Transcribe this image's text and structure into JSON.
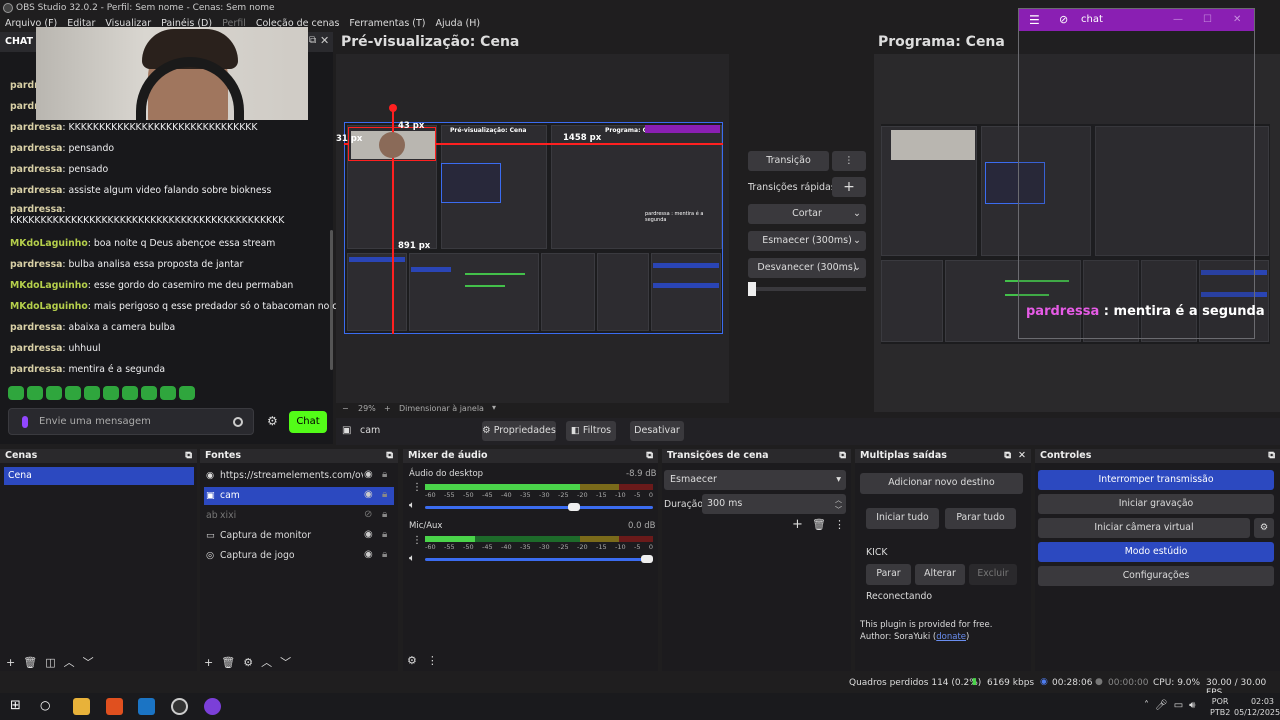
{
  "window": {
    "title": "OBS Studio 32.0.2 - Perfil: Sem nome - Cenas: Sem nome"
  },
  "menu": [
    "Arquivo (F)",
    "Editar",
    "Visualizar",
    "Painéis (D)",
    "Perfil",
    "Coleção de cenas",
    "Ferramentas (T)",
    "Ajuda (H)"
  ],
  "chat_dock": {
    "title": "CHAT K",
    "messages": [
      {
        "user": "pardre",
        "text": ""
      },
      {
        "user": "pardre",
        "text": ""
      },
      {
        "user": "pardressa",
        "text": "KKKKKKKKKKKKKKKKKKKKKKKKKKKKKKK"
      },
      {
        "user": "pardressa",
        "text": "pensando"
      },
      {
        "user": "pardressa",
        "text": "pensado"
      },
      {
        "user": "pardressa",
        "text": "assiste algum video falando sobre biokness"
      },
      {
        "user": "pardressa",
        "text": "KKKKKKKKKKKKKKKKKKKKKKKKKKKKKKKKKKKKKKKKKKKKK"
      },
      {
        "user": "MKdoLaguinho",
        "text": "boa noite q Deus abençoe essa stream"
      },
      {
        "user": "pardressa",
        "text": "bulba analisa essa proposta de jantar"
      },
      {
        "user": "MKdoLaguinho",
        "text": "esse gordo do casemiro me deu permaban"
      },
      {
        "user": "MKdoLaguinho",
        "text": "mais perigoso q esse predador só o tabacoman no cio"
      },
      {
        "user": "pardressa",
        "text": "abaixa a camera bulba"
      },
      {
        "user": "pardressa",
        "text": "uhhuul"
      },
      {
        "user": "pardressa",
        "text": "mentira é a segunda"
      }
    ],
    "input_placeholder": "Envie uma mensagem",
    "chat_button": "Chat",
    "accent": "#53fc18"
  },
  "preview": {
    "title": "Pré-visualização: Cena",
    "labels": {
      "top": "43 px",
      "left": "31 px",
      "right": "1458 px",
      "bottom": "891 px"
    },
    "zoom": "29%",
    "scale_mode": "Dimensionar à janela"
  },
  "program": {
    "title": "Programa: Cena"
  },
  "mini": {
    "prev_title": "Pré-visualização: Cena",
    "prog_title": "Programa: Cena",
    "overlay_msg": "pardressa : mentira é a segunda"
  },
  "chat_window": {
    "title": "chat",
    "overlay_user": "pardressa",
    "overlay_text": " : mentira é a segunda"
  },
  "transition_panel": {
    "transition": "Transição",
    "quick": "Transições rápidas",
    "cut": "Cortar",
    "fade": "Esmaecer (300ms)",
    "vanish": "Desvanecer (300ms)"
  },
  "source_toolbar": {
    "source": "cam",
    "properties": "Propriedades",
    "filters": "Filtros",
    "deactivate": "Desativar"
  },
  "scenes": {
    "title": "Cenas",
    "items": [
      "Cena"
    ]
  },
  "sources": {
    "title": "Fontes",
    "items": [
      "https://streamelements.com/overl",
      "cam",
      "xixi",
      "Captura de monitor",
      "Captura de jogo"
    ]
  },
  "mixer": {
    "title": "Mixer de áudio",
    "channels": [
      {
        "name": "Áudio do desktop",
        "db": "-8.9 dB",
        "level": 0.68,
        "volume": 0.68
      },
      {
        "name": "Mic/Aux",
        "db": "0.0 dB",
        "level": 0.22,
        "volume": 1.0
      }
    ],
    "scale": [
      "-60",
      "-55",
      "-50",
      "-45",
      "-40",
      "-35",
      "-30",
      "-25",
      "-20",
      "-15",
      "-10",
      "-5",
      "0"
    ]
  },
  "scene_transitions": {
    "title": "Transições de cena",
    "type": "Esmaecer",
    "duration_label": "Duração",
    "duration": "300 ms"
  },
  "multi_output": {
    "title": "Multiplas saídas",
    "add": "Adicionar novo destino",
    "start_all": "Iniciar tudo",
    "stop_all": "Parar tudo",
    "target": "KICK",
    "stop": "Parar",
    "change": "Alterar",
    "delete": "Excluir",
    "status": "Reconectando",
    "note1": "This plugin is provided for free.",
    "note2_prefix": "Author: SoraYuki (",
    "note2_link": "donate",
    "note2_suffix": ")"
  },
  "controls": {
    "title": "Controles",
    "stop_stream": "Interromper transmissão",
    "start_rec": "Iniciar gravação",
    "virtual_cam": "Iniciar câmera virtual",
    "studio": "Modo estúdio",
    "settings": "Configurações"
  },
  "status": {
    "dropped": "Quadros perdidos 114 (0.2%)",
    "bitrate": "6169 kbps",
    "live": "00:28:06",
    "rec": "00:00:00",
    "cpu": "CPU: 9.0%",
    "fps": "30.00 / 30.00 FPS"
  },
  "taskbar": {
    "lang": "POR",
    "layout": "PTB2",
    "time": "02:03",
    "date": "05/12/2025"
  }
}
